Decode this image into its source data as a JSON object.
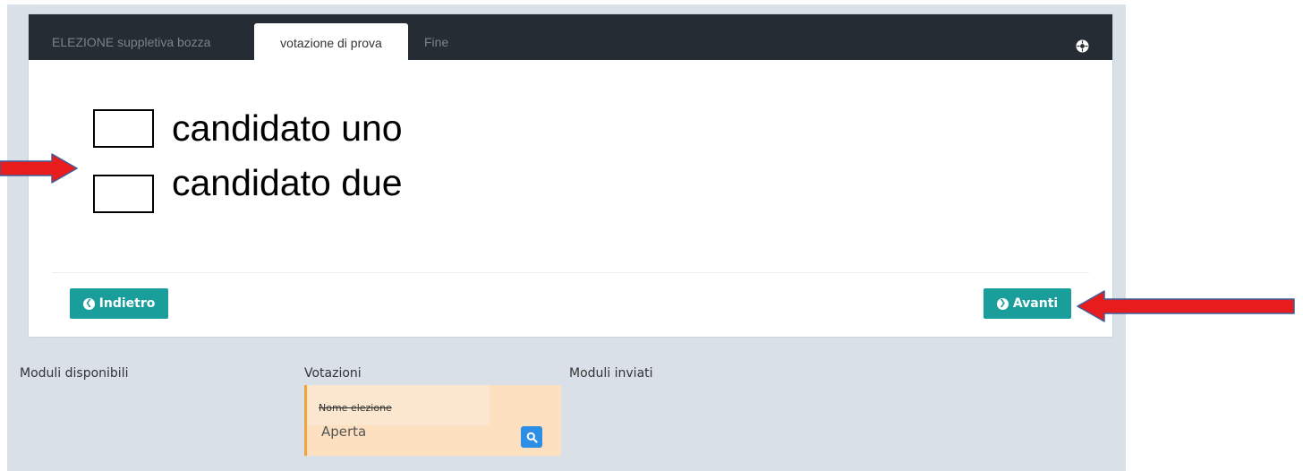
{
  "tabs": [
    {
      "label": "ELEZIONE suppletiva bozza",
      "active": false
    },
    {
      "label": "votazione di prova",
      "active": true
    },
    {
      "label": "Fine",
      "active": false
    }
  ],
  "ballot": {
    "options": [
      {
        "label": "candidato uno"
      },
      {
        "label": "candidato due"
      }
    ]
  },
  "nav": {
    "back_label": "Indietro",
    "next_label": "Avanti"
  },
  "sections": {
    "available": "Moduli disponibili",
    "votes": "Votazioni",
    "sent": "Moduli inviati"
  },
  "vote_card": {
    "name": "Nome elezione",
    "status": "Aperta"
  },
  "colors": {
    "tabbar": "#262c33",
    "button": "#1a9e9b",
    "accent_orange": "#f0a43a",
    "search_button": "#2d8ee6",
    "annotation_arrow": "#e81c1c"
  },
  "icons": {
    "tab_tools": "crosshair-circle-icon",
    "back": "chevron-left-circle-icon",
    "next": "chevron-right-circle-icon",
    "search": "search-icon",
    "annotation": "red-arrow-icon"
  }
}
